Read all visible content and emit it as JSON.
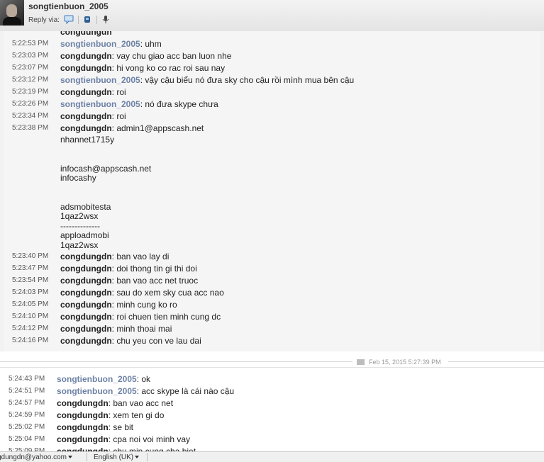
{
  "header": {
    "contact_name": "songtienbuon_2005",
    "reply_via_label": "Reply via:",
    "icons": [
      "chat-icon",
      "phone-icon",
      "microphone-icon"
    ]
  },
  "conversation1": {
    "messages": [
      {
        "time": "5:22:53 PM",
        "sender": "songtienbuon_2005",
        "text": ": uhm"
      },
      {
        "time": "5:23:03 PM",
        "sender": "congdungdn",
        "text": ": vay chu giao acc ban luon nhe"
      },
      {
        "time": "5:23:07 PM",
        "sender": "congdungdn",
        "text": ": hi vong ko co rac roi sau nay"
      },
      {
        "time": "5:23:12 PM",
        "sender": "songtienbuon_2005",
        "text": ": vậy cậu biểu nó đưa sky cho cậu rồi mình mua bên cậu"
      },
      {
        "time": "5:23:19 PM",
        "sender": "congdungdn",
        "text": ": roi"
      },
      {
        "time": "5:23:26 PM",
        "sender": "songtienbuon_2005",
        "text": ": nó đưa skype chưa"
      },
      {
        "time": "5:23:34 PM",
        "sender": "congdungdn",
        "text": ": roi"
      },
      {
        "time": "5:23:38 PM",
        "sender": "congdungdn",
        "text": ": admin1@appscash.net"
      }
    ],
    "continuation": [
      "nhannet1715y",
      "",
      "",
      "infocash@appscash.net",
      "infocashy",
      "",
      "",
      "adsmobitesta",
      "1qaz2wsx",
      "--------------",
      "apploadmobi",
      "1qaz2wsx"
    ],
    "messages_after": [
      {
        "time": "5:23:40 PM",
        "sender": "congdungdn",
        "text": ": ban vao lay di"
      },
      {
        "time": "5:23:47 PM",
        "sender": "congdungdn",
        "text": ": doi thong tin gi thi doi"
      },
      {
        "time": "5:23:54 PM",
        "sender": "congdungdn",
        "text": ": ban vao acc net truoc"
      },
      {
        "time": "5:24:03 PM",
        "sender": "congdungdn",
        "text": ": sau do xem sky cua acc nao"
      },
      {
        "time": "5:24:05 PM",
        "sender": "congdungdn",
        "text": ": minh cung ko ro"
      },
      {
        "time": "5:24:10 PM",
        "sender": "congdungdn",
        "text": ": roi chuen tien minh cung dc"
      },
      {
        "time": "5:24:12 PM",
        "sender": "congdungdn",
        "text": ": minh thoai mai"
      },
      {
        "time": "5:24:16 PM",
        "sender": "congdungdn",
        "text": ": chu yeu con ve lau dai"
      }
    ]
  },
  "divider": {
    "date": "Feb 15, 2015 5:27:39 PM"
  },
  "conversation2": {
    "messages": [
      {
        "time": "5:24:43 PM",
        "sender": "songtienbuon_2005",
        "text": ": ok"
      },
      {
        "time": "5:24:51 PM",
        "sender": "songtienbuon_2005",
        "text": ": acc skype là cái nào cậu"
      },
      {
        "time": "5:24:57 PM",
        "sender": "congdungdn",
        "text": ": ban vao acc net"
      },
      {
        "time": "5:24:59 PM",
        "sender": "congdungdn",
        "text": ": xem ten gi do"
      },
      {
        "time": "5:25:02 PM",
        "sender": "congdungdn",
        "text": ": se bit"
      },
      {
        "time": "5:25:04 PM",
        "sender": "congdungdn",
        "text": ": cpa noi voi minh vay"
      },
      {
        "time": "5:25:09 PM",
        "sender": "congdungdn",
        "text": ": chu min cung cha biet"
      }
    ]
  },
  "statusbar": {
    "account": "gdungdn@yahoo.com",
    "language": "English (UK)"
  },
  "colors": {
    "other_sender": "#6d82a6",
    "self_sender": "#222222",
    "block_bg": "#f5f5f5"
  }
}
